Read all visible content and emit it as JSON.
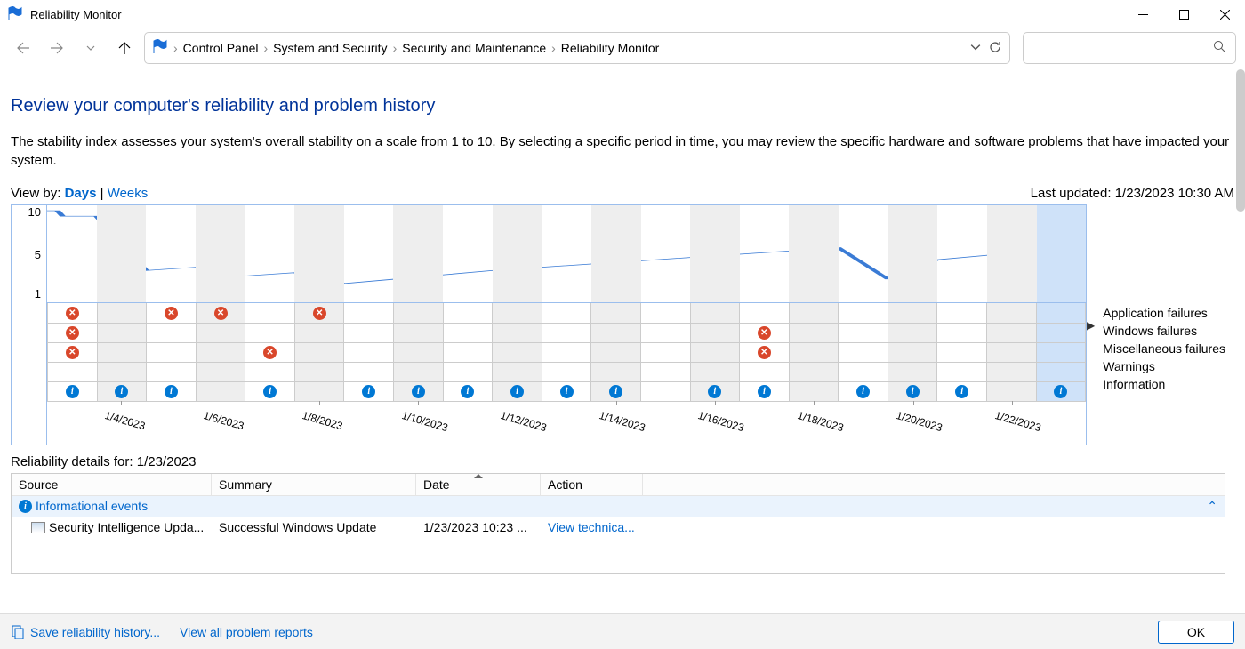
{
  "window": {
    "title": "Reliability Monitor"
  },
  "breadcrumbs": [
    "Control Panel",
    "System and Security",
    "Security and Maintenance",
    "Reliability Monitor"
  ],
  "page": {
    "heading": "Review your computer's reliability and problem history",
    "description": "The stability index assesses your system's overall stability on a scale from 1 to 10. By selecting a specific period in time, you may review the specific hardware and software problems that have impacted your system."
  },
  "viewby": {
    "label": "View by:",
    "days": "Days",
    "weeks": "Weeks"
  },
  "lastupdated": {
    "label": "Last updated:",
    "value": "1/23/2023 10:30 AM"
  },
  "chart_data": {
    "type": "line",
    "ylim": [
      1,
      10
    ],
    "xlabels": [
      "1/4/2023",
      "1/6/2023",
      "1/8/2023",
      "1/10/2023",
      "1/12/2023",
      "1/14/2023",
      "1/16/2023",
      "1/18/2023",
      "1/20/2023",
      "1/22/2023"
    ],
    "columns": 21,
    "stability": [
      9.0,
      4.0,
      4.3,
      3.5,
      3.8,
      2.8,
      3.2,
      3.6,
      4.0,
      4.3,
      4.6,
      4.9,
      5.2,
      5.5,
      5.8,
      6.1,
      3.2,
      5.0,
      5.4,
      5.8,
      6.2
    ],
    "selected_column": 20,
    "yticks": [
      10,
      5,
      1
    ]
  },
  "row_labels": [
    "Application failures",
    "Windows failures",
    "Miscellaneous failures",
    "Warnings",
    "Information"
  ],
  "events": {
    "app_failures": [
      "x",
      "",
      "x",
      "x",
      "",
      "x",
      "",
      "",
      "",
      "",
      "",
      "",
      "",
      "",
      "",
      "",
      "",
      "",
      "",
      "",
      ""
    ],
    "win_failures": [
      "x",
      "",
      "",
      "",
      "",
      "",
      "",
      "",
      "",
      "",
      "",
      "",
      "",
      "",
      "x",
      "",
      "",
      "",
      "",
      "",
      ""
    ],
    "misc_failures": [
      "x",
      "",
      "",
      "",
      "x",
      "",
      "",
      "",
      "",
      "",
      "",
      "",
      "",
      "",
      "x",
      "",
      "",
      "",
      "",
      "",
      ""
    ],
    "warnings": [
      "",
      "",
      "",
      "",
      "",
      "",
      "",
      "",
      "",
      "",
      "",
      "",
      "",
      "",
      "",
      "",
      "",
      "",
      "",
      "",
      ""
    ],
    "information": [
      "i",
      "i",
      "i",
      "",
      "i",
      "",
      "i",
      "i",
      "i",
      "i",
      "i",
      "i",
      "",
      "i",
      "i",
      "",
      "i",
      "i",
      "i",
      "",
      "i"
    ]
  },
  "details": {
    "label_prefix": "Reliability details for:",
    "date": "1/23/2023",
    "columns": {
      "source": "Source",
      "summary": "Summary",
      "date": "Date",
      "action": "Action"
    },
    "group": "Informational events",
    "rows": [
      {
        "source": "Security Intelligence Upda...",
        "summary": "Successful Windows Update",
        "date": "1/23/2023 10:23 ...",
        "action": "View technica..."
      }
    ]
  },
  "footer": {
    "save": "Save reliability history...",
    "viewall": "View all problem reports",
    "ok": "OK"
  }
}
